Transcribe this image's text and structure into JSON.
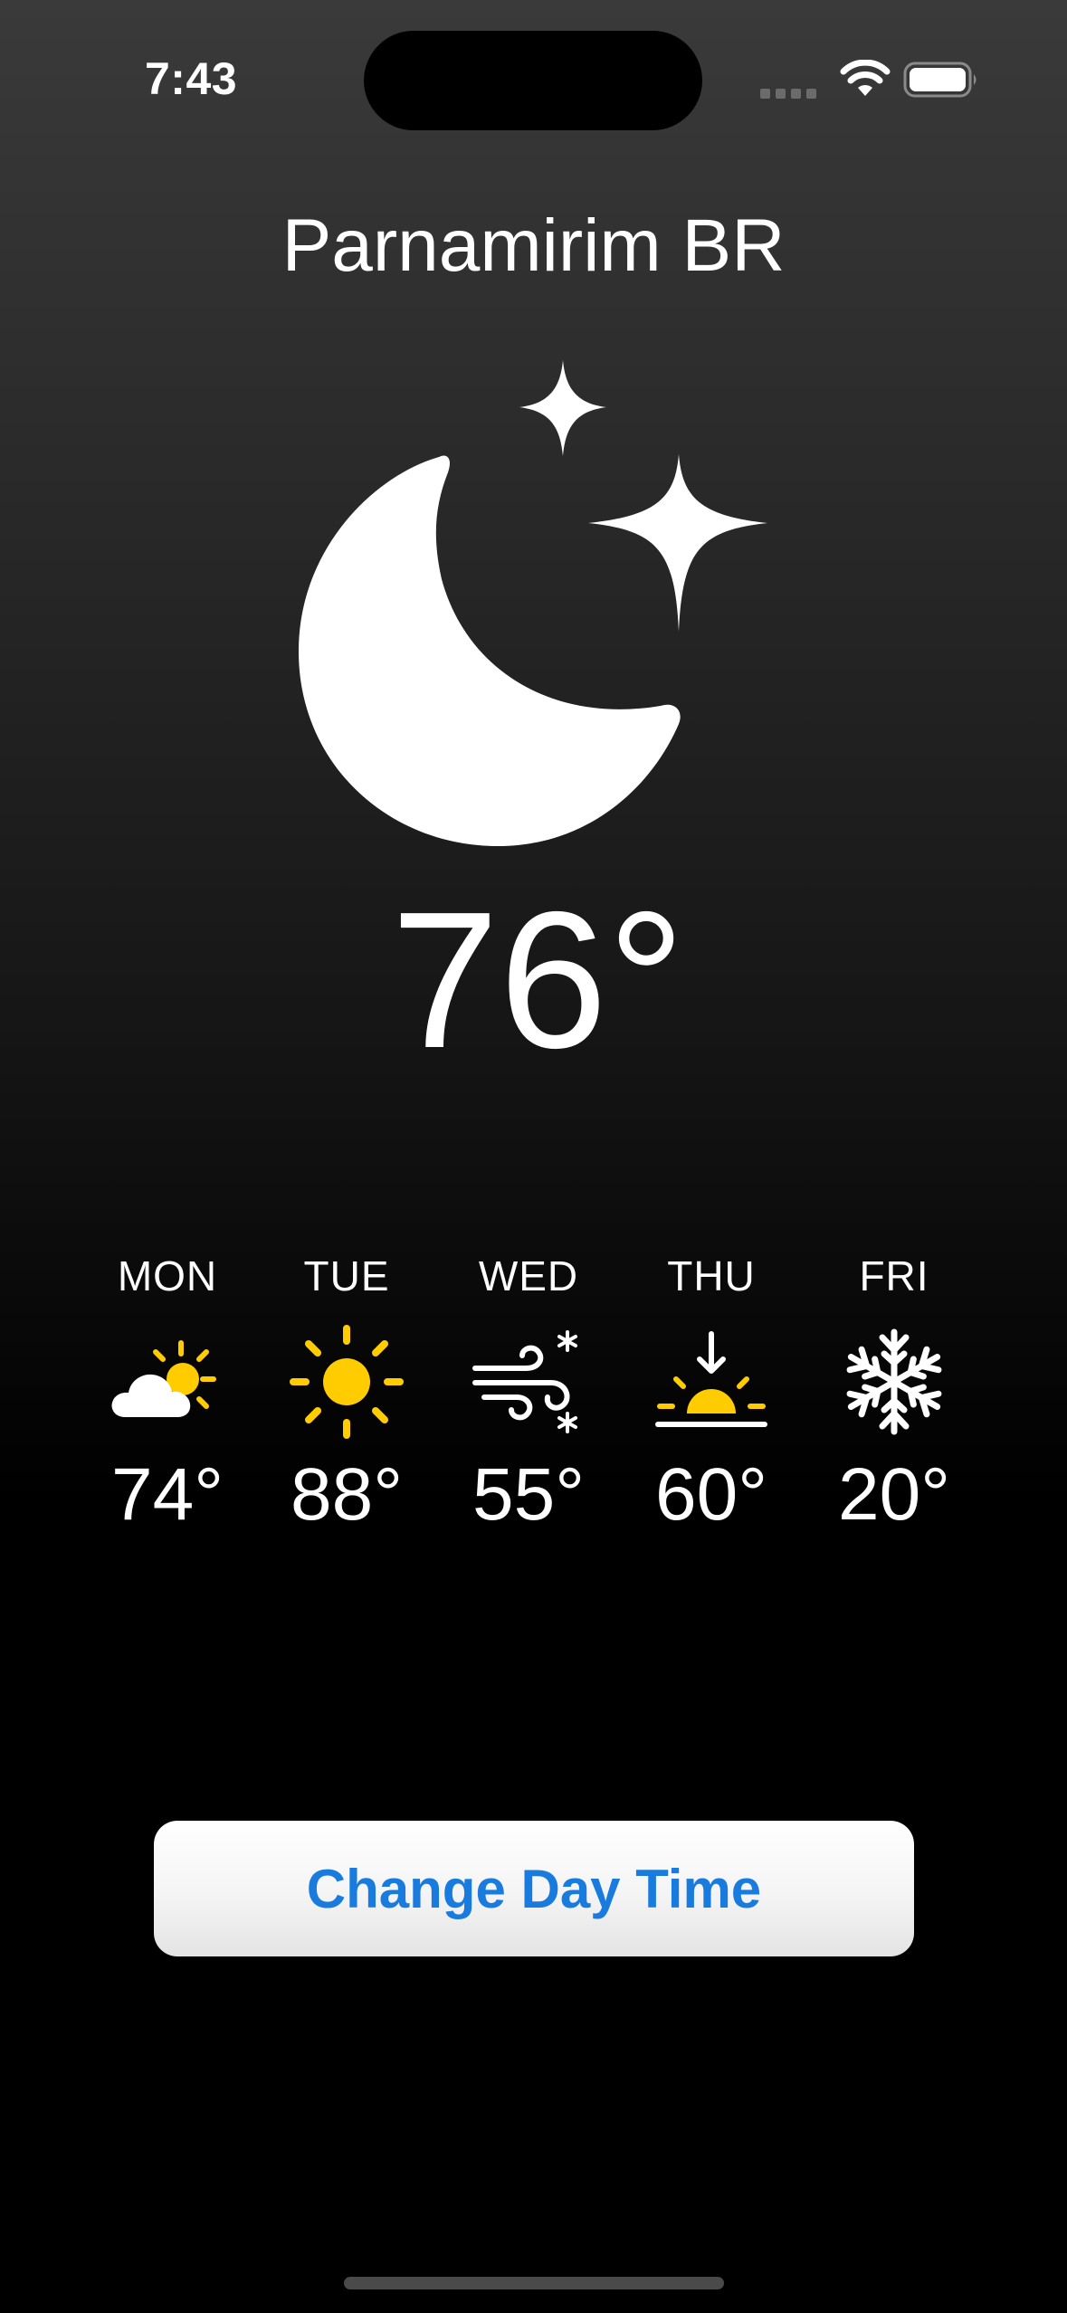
{
  "status_bar": {
    "time": "7:43"
  },
  "location": "Parnamirim BR",
  "current": {
    "temperature": "76°",
    "icon": "moon-stars-icon"
  },
  "forecast": [
    {
      "day": "MON",
      "temp": "74°",
      "icon": "cloud-sun-icon"
    },
    {
      "day": "TUE",
      "temp": "88°",
      "icon": "sun-icon"
    },
    {
      "day": "WED",
      "temp": "55°",
      "icon": "wind-snow-icon"
    },
    {
      "day": "THU",
      "temp": "60°",
      "icon": "sunset-icon"
    },
    {
      "day": "FRI",
      "temp": "20°",
      "icon": "snowflake-icon"
    }
  ],
  "button": {
    "label": "Change Day Time"
  },
  "colors": {
    "accent": "#1a7bdf",
    "sun_yellow": "#ffcc00",
    "text": "#ffffff"
  }
}
